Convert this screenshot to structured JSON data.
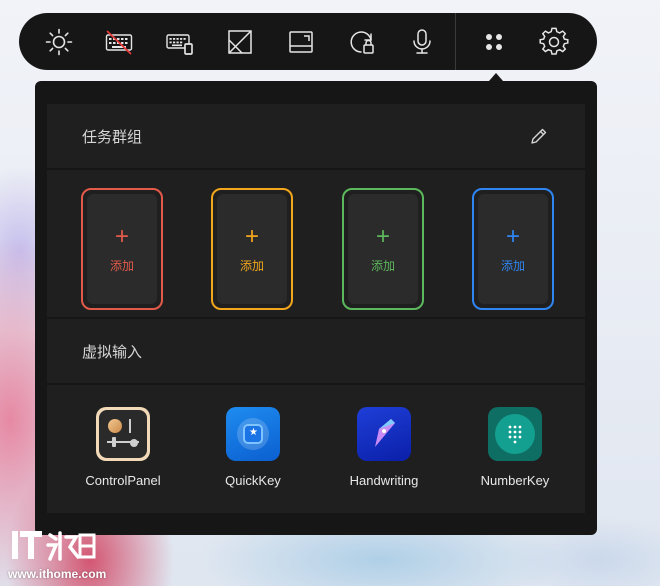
{
  "toolbar": {
    "items": [
      {
        "icon": "brightness-icon"
      },
      {
        "icon": "keyboard-disabled-icon"
      },
      {
        "icon": "keyboard-layout-icon"
      },
      {
        "icon": "screen-crop-icon"
      },
      {
        "icon": "screen-region-icon"
      },
      {
        "icon": "rotation-lock-icon"
      },
      {
        "icon": "microphone-icon"
      },
      {
        "icon": "apps-grid-icon"
      },
      {
        "icon": "gear-icon"
      }
    ]
  },
  "task_groups": {
    "title": "任务群组",
    "edit_icon": "pencil-icon",
    "cards": [
      {
        "plus": "+",
        "label": "添加",
        "color": "#e25a4a"
      },
      {
        "plus": "+",
        "label": "添加",
        "color": "#f2a61c"
      },
      {
        "plus": "+",
        "label": "添加",
        "color": "#5cb85c"
      },
      {
        "plus": "+",
        "label": "添加",
        "color": "#2f86f2"
      }
    ]
  },
  "virtual_input": {
    "title": "虚拟输入",
    "apps": [
      {
        "name": "ControlPanel",
        "icon": "control-panel-icon"
      },
      {
        "name": "QuickKey",
        "icon": "quickkey-icon"
      },
      {
        "name": "Handwriting",
        "icon": "handwriting-icon"
      },
      {
        "name": "NumberKey",
        "icon": "numberkey-icon"
      }
    ]
  },
  "watermark": {
    "logo": "IT之家",
    "url": "www.ithome.com"
  }
}
